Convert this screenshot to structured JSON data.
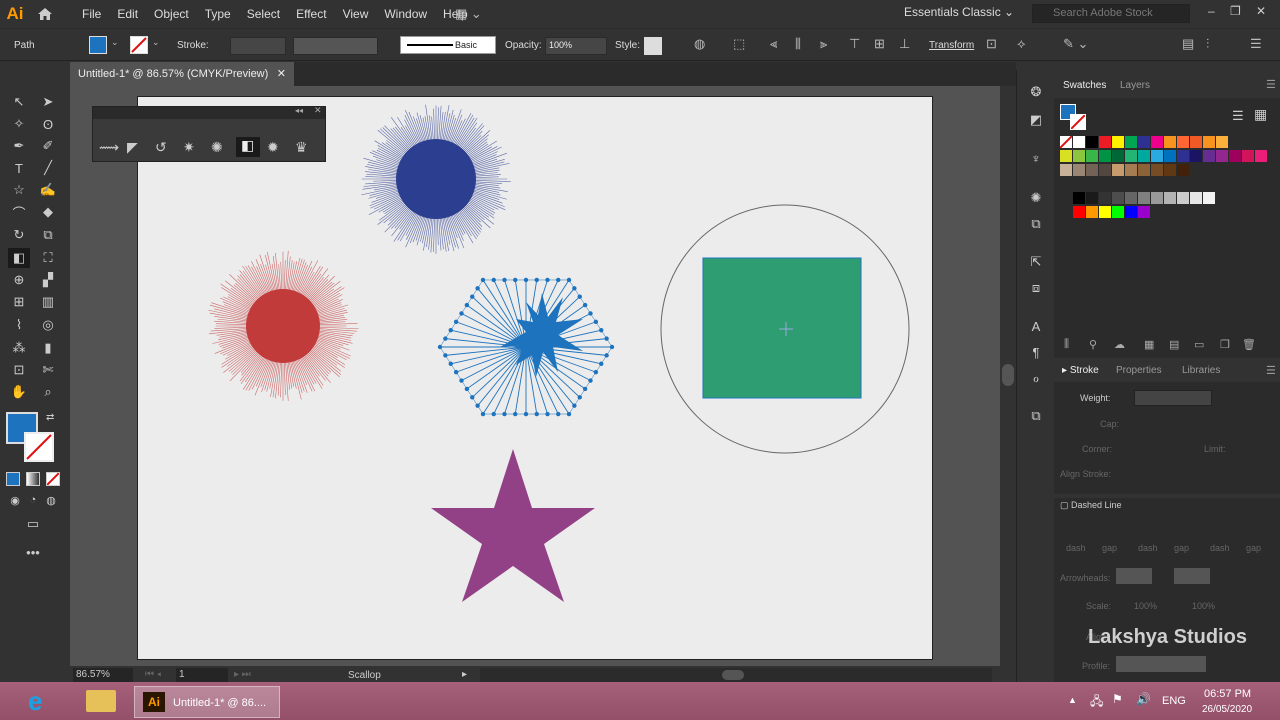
{
  "app": {
    "logo": "Ai",
    "menus": [
      "File",
      "Edit",
      "Object",
      "Type",
      "Select",
      "Effect",
      "View",
      "Window",
      "Help"
    ],
    "workspace": "Essentials Classic",
    "search_placeholder": "Search Adobe Stock"
  },
  "control": {
    "selection": "Path",
    "stroke_label": "Stroke:",
    "brush": "Basic",
    "opacity_label": "Opacity:",
    "opacity": "100%",
    "style_label": "Style:",
    "transform": "Transform",
    "fill_color": "#1e73be"
  },
  "document": {
    "tab_title": "Untitled-1* @ 86.57% (CMYK/Preview)",
    "zoom": "86.57%",
    "page": "1",
    "status": "Scallop"
  },
  "panels": {
    "swatches_tab": "Swatches",
    "layers_tab": "Layers",
    "stroke_tab": "Stroke",
    "properties_tab": "Properties",
    "libraries_tab": "Libraries",
    "weight_label": "Weight:",
    "cap_label": "Cap:",
    "corner_label": "Corner:",
    "limit_label": "Limit:",
    "align_label": "Align Stroke:",
    "dashed_label": "Dashed Line",
    "dash_labels": [
      "dash",
      "gap",
      "dash",
      "gap",
      "dash",
      "gap"
    ],
    "arrowheads_label": "Arrowheads:",
    "scale_label": "Scale:",
    "scale_values": [
      "100%",
      "100%"
    ],
    "align_label2": "Align:",
    "profile_label": "Profile:"
  },
  "swatch_colors": {
    "row1": [
      "#ffffff",
      "#000000",
      "#ed1c24",
      "#fff200",
      "#00a651",
      "#2e3192",
      "#ec008c",
      "#f7941d",
      "#ff6633",
      "#f15a24",
      "#f7931e",
      "#fbb03b"
    ],
    "row2": [
      "#d9e021",
      "#8cc63f",
      "#39b54a",
      "#009245",
      "#006837",
      "#22b573",
      "#00a99d",
      "#29abe2",
      "#0071bc",
      "#2e3192",
      "#1b1464",
      "#662d91",
      "#93278f",
      "#9e005d",
      "#d4145a",
      "#ed1e79"
    ],
    "row3": [
      "#c7b299",
      "#998675",
      "#736357",
      "#534741",
      "#c69c6d",
      "#a67c52",
      "#8c6239",
      "#754c24",
      "#603813",
      "#42210b"
    ],
    "gray": [
      "#000000",
      "#1a1a1a",
      "#333333",
      "#4d4d4d",
      "#666666",
      "#808080",
      "#999999",
      "#b3b3b3",
      "#cccccc",
      "#e6e6e6",
      "#f2f2f2"
    ],
    "group": [
      "#ff0000",
      "#ff9900",
      "#ffff00",
      "#00ff00",
      "#0000ff",
      "#9900cc"
    ]
  },
  "artwork": {
    "blue_burst": "#2c3e8f",
    "red_burst": "#c23b3b",
    "hex_burst": "#1e73be",
    "green_rect": "#2e9e72",
    "star": "#934187"
  },
  "taskbar": {
    "app_label": "Untitled-1* @ 86....",
    "lang": "ENG",
    "time": "06:57 PM",
    "date": "26/05/2020"
  },
  "watermark": "Lakshya Studios"
}
